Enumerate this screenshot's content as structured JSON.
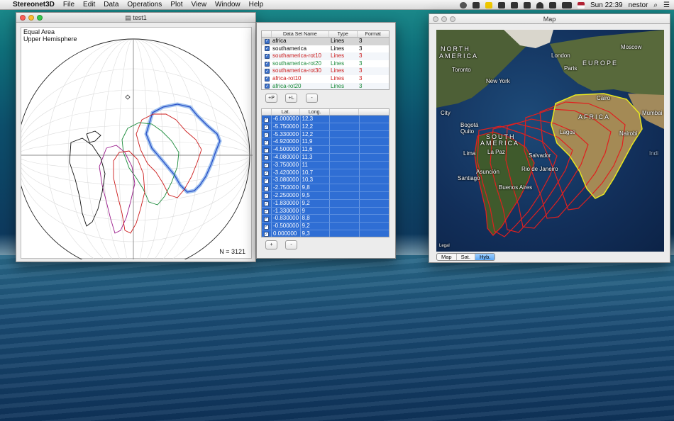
{
  "menubar": {
    "app": "Stereonet3D",
    "items": [
      "File",
      "Edit",
      "Data",
      "Operations",
      "Plot",
      "View",
      "Window",
      "Help"
    ],
    "clock": "Sun 22:39",
    "user": "nestor"
  },
  "stereonet_window": {
    "title": "test1",
    "projection": "Equal Area",
    "hemisphere": "Upper Hemisphere",
    "count": "N = 3121"
  },
  "dataset_table": {
    "headers": [
      "Data Set Name",
      "Type",
      "Format"
    ],
    "rows": [
      {
        "name": "africa",
        "type": "Lines",
        "format": "3",
        "color": "#000000"
      },
      {
        "name": "southamerica",
        "type": "Lines",
        "format": "3",
        "color": "#000000"
      },
      {
        "name": "southamerica-rot10",
        "type": "Lines",
        "format": "3",
        "color": "#cc1a1a"
      },
      {
        "name": "southamerica-rot20",
        "type": "Lines",
        "format": "3",
        "color": "#1a8a3a"
      },
      {
        "name": "southamerica-rot30",
        "type": "Lines",
        "format": "3",
        "color": "#cc1a1a"
      },
      {
        "name": "africa-rot10",
        "type": "Lines",
        "format": "3",
        "color": "#cc1a1a"
      },
      {
        "name": "africa-rot20",
        "type": "Lines",
        "format": "3",
        "color": "#1a8a3a"
      }
    ],
    "buttons": [
      "+P",
      "+L",
      "-"
    ]
  },
  "points_table": {
    "headers": [
      "Lat.",
      "Long."
    ],
    "rows": [
      [
        "-6.000000",
        "12,3"
      ],
      [
        "-5.750000",
        "12,2"
      ],
      [
        "-5.330000",
        "12,2"
      ],
      [
        "-4.920000",
        "11,9"
      ],
      [
        "-4.500000",
        "11,6"
      ],
      [
        "-4.080000",
        "11,3"
      ],
      [
        "-3.750000",
        "11"
      ],
      [
        "-3.420000",
        "10,7"
      ],
      [
        "-3.080000",
        "10,3"
      ],
      [
        "-2.750000",
        "9,8"
      ],
      [
        "-2.250000",
        "9,5"
      ],
      [
        "-1.830000",
        "9,2"
      ],
      [
        "-1.330000",
        "9"
      ],
      [
        "-0.830000",
        "8,8"
      ],
      [
        "-0.500000",
        "9,2"
      ],
      [
        "0.000000",
        "9,3"
      ]
    ],
    "buttons": [
      "+",
      "-"
    ]
  },
  "map_window": {
    "title": "Map",
    "labels": [
      "NORTH",
      "AMERICA",
      "EUROPE",
      "London",
      "Moscow",
      "Paris",
      "Toronto",
      "New York",
      "Cairo",
      "AFRICA",
      "Mumbai",
      "Bogotá",
      "Quito",
      "SOUTH",
      "AMERICA",
      "Lima",
      "La Paz",
      "Salvador",
      "Lagos",
      "Nairobi",
      "Asunción",
      "Santiago",
      "Rio de Janeiro",
      "Buenos Aires",
      "City",
      "Indi"
    ],
    "tabs": [
      "Map",
      "Sat.",
      "Hyb."
    ],
    "active_tab": "Hyb.",
    "legal": "Legal"
  },
  "colors": {
    "black": "#111111",
    "red": "#cc1a1a",
    "green": "#1a8a3a",
    "purple": "#9a1a8a",
    "blue": "#2a50c8",
    "yellow": "#e8e820",
    "selection": "#2f6ed4"
  }
}
